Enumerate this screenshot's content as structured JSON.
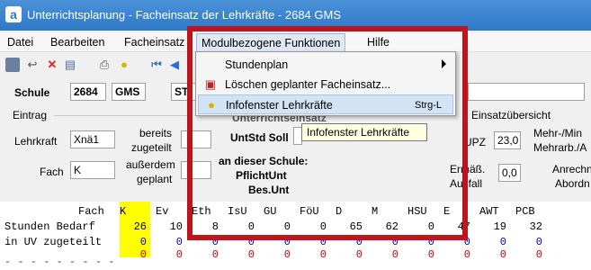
{
  "window": {
    "title": "Unterrichtsplanung - Facheinsatz der Lehrkräfte - 2684 GMS",
    "icon_letter": "a"
  },
  "menubar": {
    "items": [
      "Datei",
      "Bearbeiten",
      "Facheinsatz",
      "Modulbezogene Funktionen",
      "Hilfe"
    ]
  },
  "toolbar": {
    "icons": [
      "save-icon",
      "undo-icon",
      "delete-icon",
      "edit-icon",
      "print-icon",
      "bulb-icon",
      "first-icon",
      "prev-icon"
    ]
  },
  "school": {
    "label": "Schule",
    "code": "2684",
    "type": "GMS",
    "extra": "ST"
  },
  "eintrag": {
    "group_label": "Eintrag",
    "lehrkraft_label": "Lehrkraft",
    "lehrkraft_value": "Xnä1",
    "fach_label": "Fach",
    "fach_value": "K",
    "bereits_label": "bereits",
    "zugeteilt_label": "zugeteilt",
    "ausserdem_label": "außerdem",
    "geplant_label": "geplant",
    "untstd_soll_label": "UntStd Soll",
    "an_dieser_schule_label": "an dieser Schule:",
    "pflichtunt_label": "PflichtUnt",
    "besunt_label": "Bes.Unt",
    "unterrichtseinsatz_label": "Unterrichtseinsatz"
  },
  "einsatz": {
    "group_label": "Einsatzübersicht",
    "upz_label": "UPZ",
    "upz_value": "23,0",
    "mehr_label": "Mehr-/Min",
    "mehrarb_label": "Mehrarb./A",
    "ermaess_label": "Ermäß.",
    "ausfall_label": "Ausfall",
    "ermaess_value": "0,0",
    "anrech_label": "Anrechn",
    "abord_label": "Abordn"
  },
  "grid": {
    "row_labels": [
      "Fach",
      "Stunden Bedarf",
      "in UV zugeteilt"
    ],
    "columns": [
      {
        "name": "K",
        "bedarf": "26",
        "v1": "0",
        "v2": "0"
      },
      {
        "name": "Ev",
        "bedarf": "10",
        "v1": "0",
        "v2": "0"
      },
      {
        "name": "Eth",
        "bedarf": "8",
        "v1": "0",
        "v2": "0"
      },
      {
        "name": "IsU",
        "bedarf": "0",
        "v1": "0",
        "v2": "0"
      },
      {
        "name": "GU",
        "bedarf": "0",
        "v1": "0",
        "v2": "0"
      },
      {
        "name": "FöU",
        "bedarf": "0",
        "v1": "0",
        "v2": "0"
      },
      {
        "name": "D",
        "bedarf": "65",
        "v1": "0",
        "v2": "0"
      },
      {
        "name": "M",
        "bedarf": "62",
        "v1": "0",
        "v2": "0"
      },
      {
        "name": "HSU",
        "bedarf": "0",
        "v1": "0",
        "v2": "0"
      },
      {
        "name": "E",
        "bedarf": "47",
        "v1": "0",
        "v2": "0"
      },
      {
        "name": "AWT",
        "bedarf": "19",
        "v1": "0",
        "v2": "0"
      },
      {
        "name": "PCB",
        "bedarf": "32",
        "v1": "0",
        "v2": "0"
      }
    ]
  },
  "dropdown": {
    "items": [
      {
        "label": "Stundenplan",
        "shortcut": "",
        "submenu": true,
        "icon": ""
      },
      {
        "label": "Löschen geplanter Facheinsatz...",
        "shortcut": "",
        "submenu": false,
        "icon": "delete-plan-icon"
      },
      {
        "label": "Infofenster Lehrkräfte",
        "shortcut": "Strg-L",
        "submenu": false,
        "icon": "bulb-icon"
      }
    ]
  },
  "tooltip": {
    "text": "Infofenster Lehrkräfte"
  },
  "colors": {
    "title_bar": "#2e78c7",
    "highlight": "#ffff00",
    "annotation": "#c0141c"
  }
}
